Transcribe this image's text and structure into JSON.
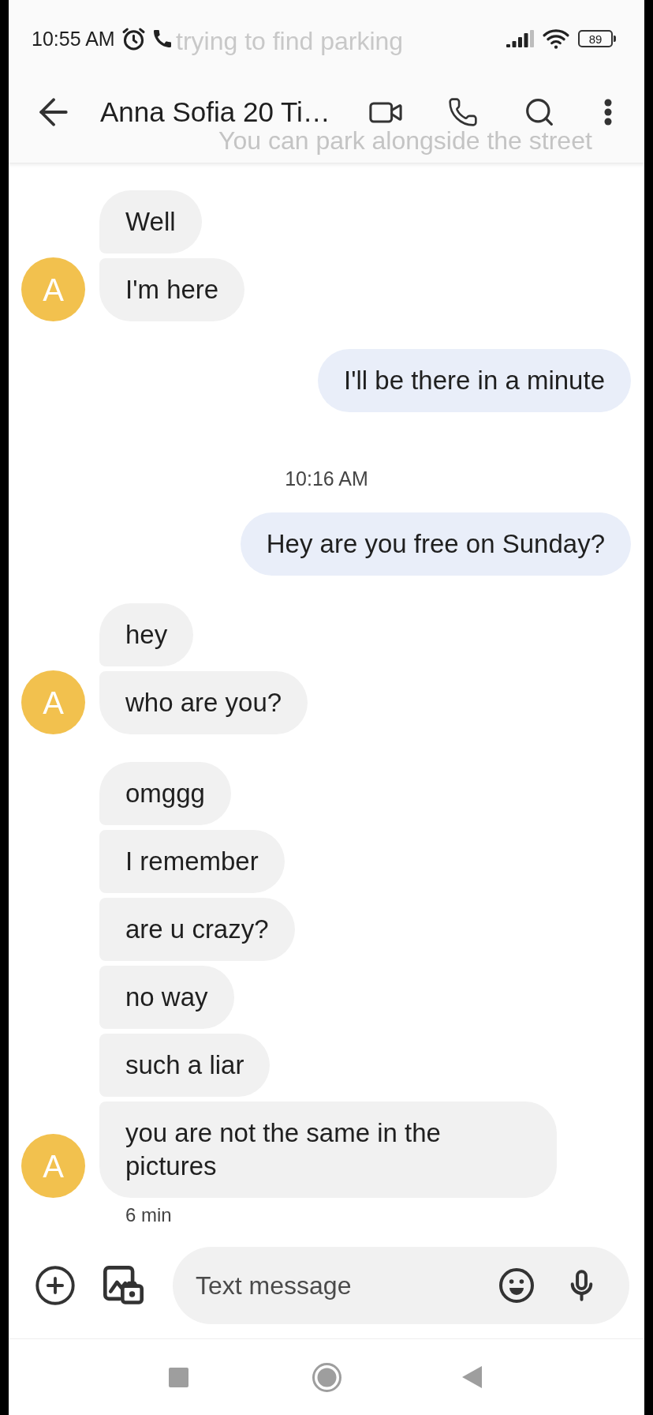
{
  "status_bar": {
    "time": "10:55 AM",
    "battery": "89"
  },
  "notification_overlay": {
    "title": "trying to find parking",
    "text": "You can park alongside the street"
  },
  "toolbar": {
    "title": "Anna Sofia 20 Ti…"
  },
  "messages": [
    {
      "kind": "incoming",
      "avatar": "A",
      "bubbles": [
        "Well",
        "I'm here"
      ]
    },
    {
      "kind": "outgoing",
      "bubbles": [
        "I'll be there in a minute"
      ]
    },
    {
      "kind": "timestamp",
      "text": "10:16 AM"
    },
    {
      "kind": "outgoing",
      "bubbles": [
        "Hey are you free on Sunday?"
      ]
    },
    {
      "kind": "incoming",
      "avatar": "A",
      "bubbles": [
        "hey",
        "who are you?"
      ]
    },
    {
      "kind": "incoming",
      "avatar": "A",
      "bubbles": [
        "omggg",
        "I remember",
        "are u crazy?",
        "no way",
        "such a liar",
        "you are not the same in the pictures"
      ],
      "caption": "6 min"
    }
  ],
  "composer": {
    "placeholder": "Text message"
  }
}
